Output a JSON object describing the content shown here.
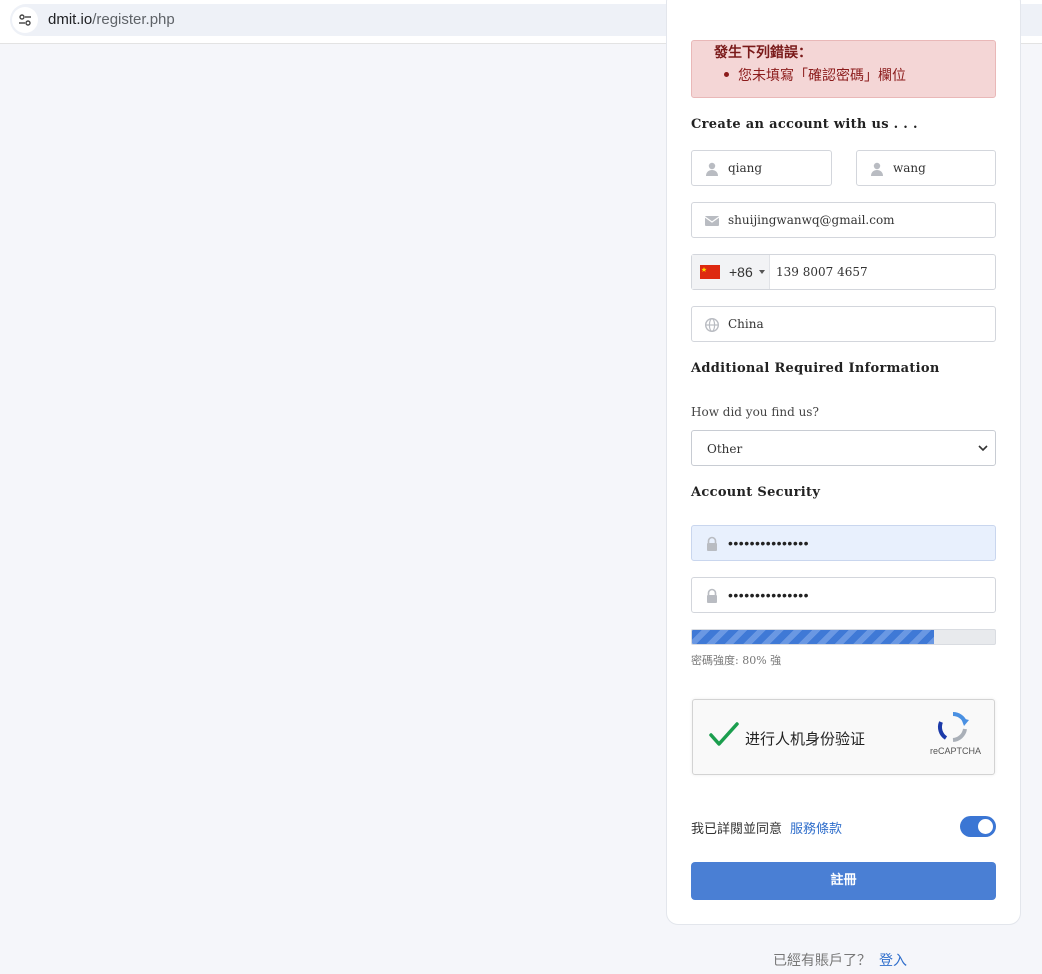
{
  "browser": {
    "url_host": "dmit.io",
    "url_path": "/register.php"
  },
  "alert": {
    "heading": "發生下列錯誤：",
    "items": [
      "您未填寫「確認密碼」欄位"
    ]
  },
  "form": {
    "create_title": "Create an account with us . . .",
    "first_name": "qiang",
    "last_name": "wang",
    "email": "shuijingwanwq@gmail.com",
    "phone_country_code": "+86",
    "phone_number": "139 8007 4657",
    "country": "China",
    "additional_title": "Additional Required Information",
    "find_us_label": "How did you find us?",
    "find_us_value": "Other",
    "security_title": "Account Security",
    "password_mask": "•••••••••••••••",
    "confirm_mask": "•••••••••••••••",
    "strength_percent": 80,
    "strength_text": "密碼強度: 80% 強",
    "captcha_text": "进行人机身份验证",
    "captcha_brand": "reCAPTCHA",
    "terms_text": "我已詳閱並同意",
    "terms_link": "服務條款",
    "terms_agreed": true,
    "submit_label": "註冊"
  },
  "footer": {
    "text": "已經有賬戶了？",
    "login_link": "登入"
  },
  "colors": {
    "accent": "#4a7fd4",
    "alert_bg": "#f4d6d6",
    "alert_text": "#7a1a1a"
  }
}
